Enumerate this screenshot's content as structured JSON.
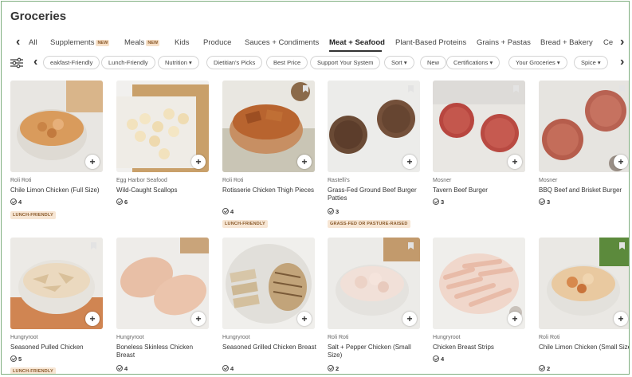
{
  "page": {
    "title": "Groceries"
  },
  "categories": {
    "all_label": "All",
    "new_badge": "NEW",
    "items": [
      {
        "label": "Supplements",
        "new": true
      },
      {
        "label": "Meals",
        "new": true
      },
      {
        "label": "Kids"
      },
      {
        "label": "Produce"
      },
      {
        "label": "Sauces + Condiments"
      },
      {
        "label": "Meat + Seafood",
        "active": true
      },
      {
        "label": "Plant-Based Proteins"
      },
      {
        "label": "Grains + Pastas"
      },
      {
        "label": "Bread + Bakery"
      },
      {
        "label": "Ce"
      }
    ]
  },
  "filters": {
    "chips": [
      "eakfast-Friendly",
      "Lunch-Friendly",
      "Nutrition",
      "Dietitian's Picks",
      "Best Price",
      "Support Your System",
      "Sort",
      "New",
      "Certifications",
      "Your Groceries",
      "Spice"
    ],
    "dropdown_chips": [
      "Nutrition",
      "Sort",
      "Certifications",
      "Your Groceries",
      "Spice"
    ]
  },
  "products": [
    {
      "brand": "Roli Roti",
      "name": "Chile Limon Chicken (Full Size)",
      "rating": "4",
      "tag": "LUNCH-FRIENDLY",
      "image": "chicken-bowl"
    },
    {
      "brand": "Egg Harbor Seafood",
      "name": "Wild-Caught Scallops",
      "rating": "6",
      "tag": "",
      "image": "scallops"
    },
    {
      "brand": "Roli Roti",
      "name": "Rotisserie Chicken Thigh Pieces",
      "rating": "4",
      "tag": "LUNCH-FRIENDLY",
      "image": "chicken-thigh"
    },
    {
      "brand": "Rastelli's",
      "name": "Grass-Fed Ground Beef Burger Patties",
      "rating": "3",
      "tag": "GRASS-FED OR PASTURE-RAISED",
      "image": "beef-patties"
    },
    {
      "brand": "Mosner",
      "name": "Tavern Beef Burger",
      "rating": "3",
      "tag": "",
      "image": "raw-patties"
    },
    {
      "brand": "Mosner",
      "name": "BBQ Beef and Brisket Burger",
      "rating": "3",
      "tag": "",
      "image": "bbq-patties"
    },
    {
      "brand": "Hungryroot",
      "name": "Seasoned Pulled Chicken",
      "rating": "5",
      "tag": "LUNCH-FRIENDLY",
      "image": "pulled-chicken"
    },
    {
      "brand": "Hungryroot",
      "name": "Boneless Skinless Chicken Breast",
      "rating": "4",
      "tag": "",
      "image": "chicken-breast"
    },
    {
      "brand": "Hungryroot",
      "name": "Seasoned Grilled Chicken Breast",
      "rating": "4",
      "tag": "",
      "image": "grilled-chicken"
    },
    {
      "brand": "Roli Roti",
      "name": "Salt + Pepper Chicken (Small Size)",
      "rating": "2",
      "tag": "",
      "image": "sp-chicken"
    },
    {
      "brand": "Hungryroot",
      "name": "Chicken Breast Strips",
      "rating": "4",
      "tag": "",
      "image": "chicken-strips"
    },
    {
      "brand": "Roli Roti",
      "name": "Chile Limon Chicken (Small Size)",
      "rating": "2",
      "tag": "",
      "image": "chile-small"
    }
  ]
}
